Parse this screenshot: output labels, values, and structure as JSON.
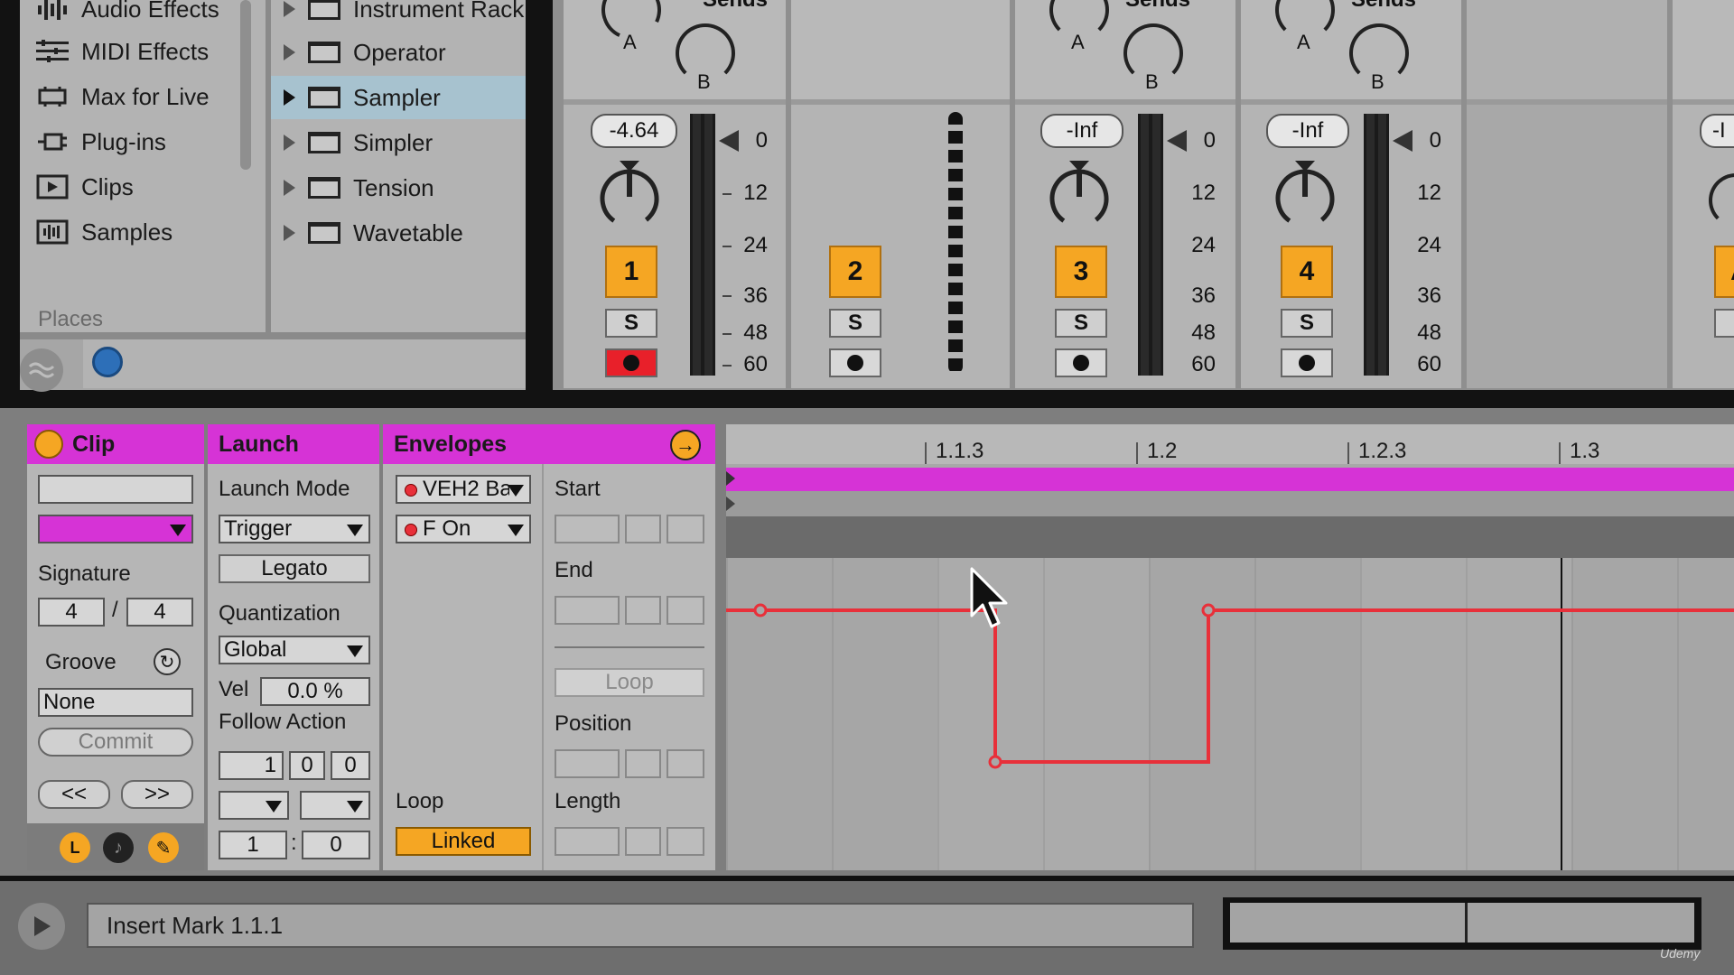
{
  "browser": {
    "categories": [
      {
        "label": "Audio Effects",
        "icon": "audio-effects-icon"
      },
      {
        "label": "MIDI Effects",
        "icon": "midi-effects-icon"
      },
      {
        "label": "Max for Live",
        "icon": "max-for-live-icon"
      },
      {
        "label": "Plug-ins",
        "icon": "plug-ins-icon"
      },
      {
        "label": "Clips",
        "icon": "clips-icon"
      },
      {
        "label": "Samples",
        "icon": "samples-icon"
      }
    ],
    "places_label": "Places",
    "devices": [
      {
        "label": "Instrument Rack",
        "selected": false
      },
      {
        "label": "Operator",
        "selected": false
      },
      {
        "label": "Sampler",
        "selected": true
      },
      {
        "label": "Simpler",
        "selected": false
      },
      {
        "label": "Tension",
        "selected": false
      },
      {
        "label": "Wavetable",
        "selected": false
      }
    ]
  },
  "mixer": {
    "sends_label": "Sends",
    "send_a": "A",
    "send_b": "B",
    "scale": [
      "0",
      "12",
      "24",
      "36",
      "48",
      "60"
    ],
    "solo_label": "S",
    "tracks": [
      {
        "number": "1",
        "volume": "-4.64",
        "armed": true
      },
      {
        "number": "2",
        "volume": "",
        "armed": false
      },
      {
        "number": "3",
        "volume": "-Inf",
        "armed": false
      },
      {
        "number": "4",
        "volume": "-Inf",
        "armed": false
      },
      {
        "number": "A",
        "volume": "-I",
        "armed": false
      }
    ]
  },
  "clip": {
    "header": "Clip",
    "signature_label": "Signature",
    "sig_num": "4",
    "sig_den": "4",
    "sig_sep": "/",
    "groove_label": "Groove",
    "groove_value": "None",
    "commit_label": "Commit",
    "prev_label": "<<",
    "next_label": ">>",
    "accent": "#d633d6"
  },
  "launch": {
    "header": "Launch",
    "mode_label": "Launch Mode",
    "mode_value": "Trigger",
    "legato_label": "Legato",
    "quant_label": "Quantization",
    "quant_value": "Global",
    "vel_label": "Vel",
    "vel_value": "0.0 %",
    "follow_label": "Follow Action",
    "follow_values": [
      "1",
      "0",
      "0"
    ],
    "bottom_a": "1",
    "bottom_sep": ":",
    "bottom_b": "0"
  },
  "envelopes": {
    "header": "Envelopes",
    "device_select": "VEH2 Ba",
    "control_select": "F On",
    "loop_label": "Loop",
    "linked_label": "Linked",
    "start_label": "Start",
    "end_label": "End",
    "loop_button": "Loop",
    "position_label": "Position",
    "length_label": "Length"
  },
  "timeline": {
    "markers": [
      "1.1.3",
      "1.2",
      "1.2.3",
      "1.3"
    ],
    "envelope_color": "#e8303a",
    "clip_bar_color": "#d633d6"
  },
  "status": {
    "message": "Insert Mark 1.1.1"
  },
  "watermark": "Udemy"
}
